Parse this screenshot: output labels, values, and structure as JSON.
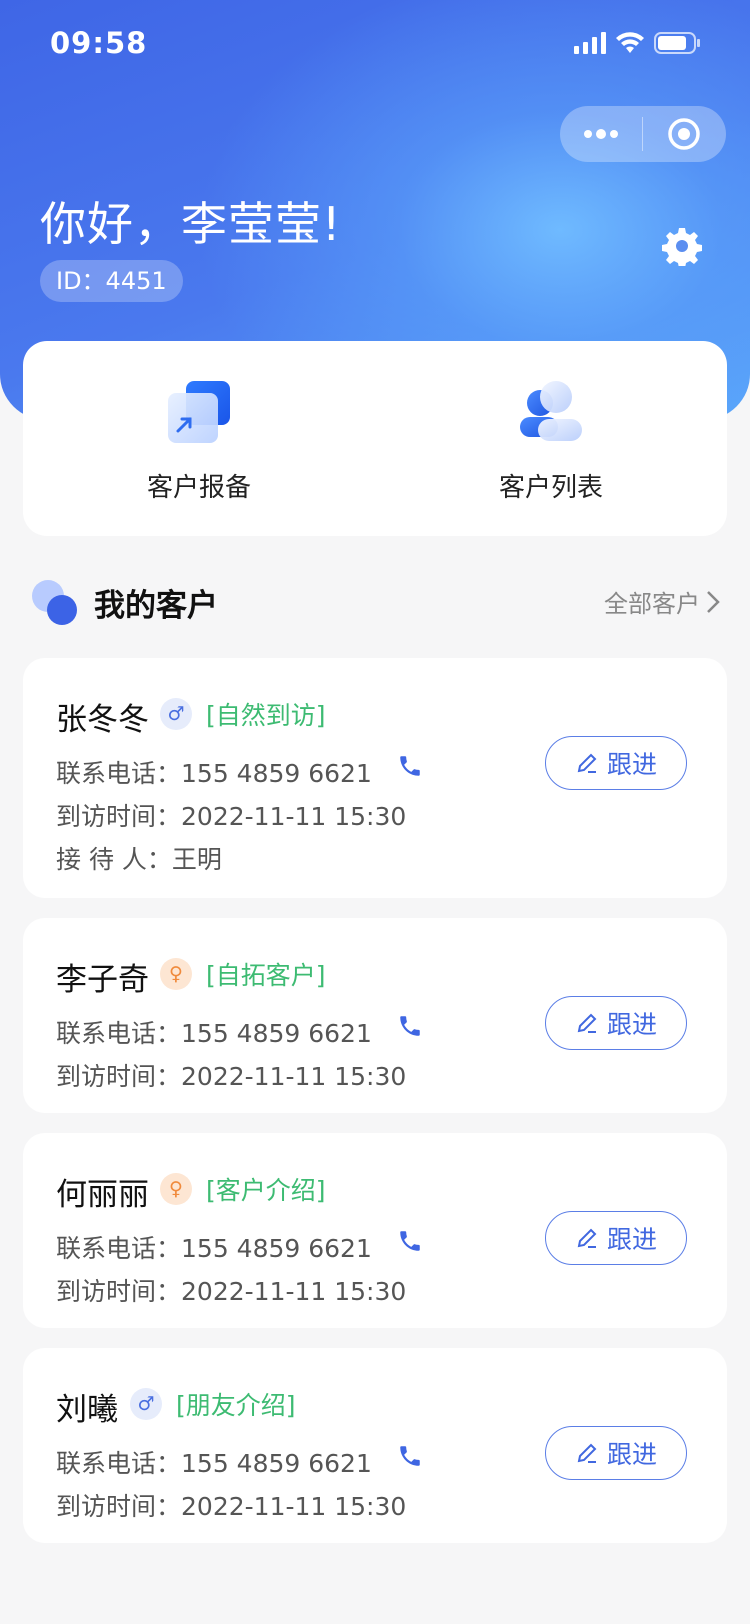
{
  "status_bar": {
    "time": "09:58"
  },
  "header": {
    "greeting": "你好，李莹莹!",
    "id_label": "ID：4451"
  },
  "quick_actions": [
    {
      "label": "客户报备",
      "icon": "report-icon"
    },
    {
      "label": "客户列表",
      "icon": "user-list-icon"
    }
  ],
  "section": {
    "title": "我的客户",
    "link_label": "全部客户"
  },
  "customers": [
    {
      "name": "张冬冬",
      "gender": "male",
      "gender_symbol": "♂",
      "source": "[自然到访]",
      "phone_label": "联系电话：",
      "phone": "155 4859 6621",
      "visit_label": "到访时间：",
      "visit_time": "2022-11-11  15:30",
      "receiver_label": "接 待 人：",
      "receiver": "王明",
      "follow_label": "跟进"
    },
    {
      "name": "李子奇",
      "gender": "female",
      "gender_symbol": "♀",
      "source": "[自拓客户]",
      "phone_label": "联系电话：",
      "phone": "155 4859 6621",
      "visit_label": "到访时间：",
      "visit_time": "2022-11-11  15:30",
      "follow_label": "跟进"
    },
    {
      "name": "何丽丽",
      "gender": "female",
      "gender_symbol": "♀",
      "source": "[客户介绍]",
      "phone_label": "联系电话：",
      "phone": "155 4859 6621",
      "visit_label": "到访时间：",
      "visit_time": "2022-11-11  15:30",
      "follow_label": "跟进"
    },
    {
      "name": "刘曦",
      "gender": "male",
      "gender_symbol": "♂",
      "source": "[朋友介绍]",
      "phone_label": "联系电话：",
      "phone": "155 4859 6621",
      "visit_label": "到访时间：",
      "visit_time": "2022-11-11  15:30",
      "follow_label": "跟进"
    }
  ],
  "colors": {
    "primary": "#4168e0",
    "source_tag": "#3dbb72",
    "female_badge": "#f08a3c"
  }
}
